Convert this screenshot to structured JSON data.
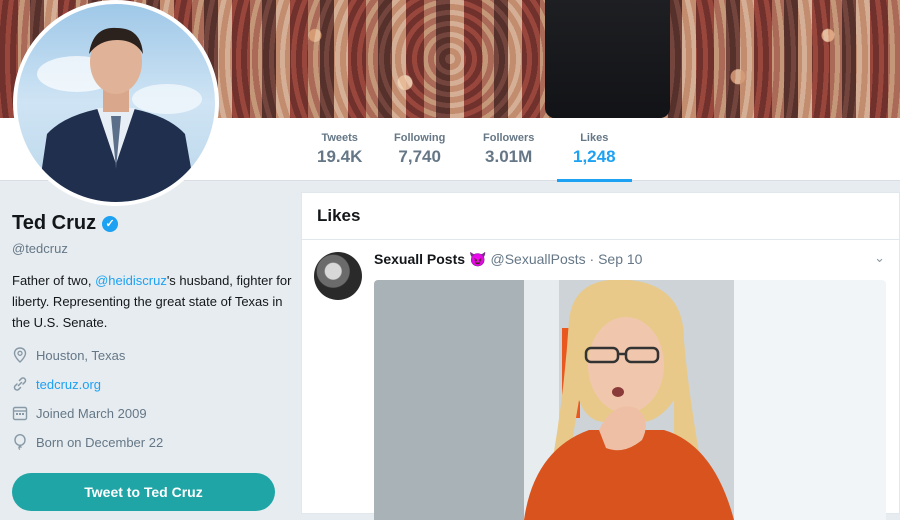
{
  "profile": {
    "name": "Ted Cruz",
    "handle": "@tedcruz",
    "bio_prefix": "Father of two, ",
    "bio_mention": "@heidiscruz",
    "bio_suffix": "'s husband, fighter for liberty. Representing the great state of Texas in the U.S. Senate.",
    "location": "Houston, Texas",
    "website": "tedcruz.org",
    "joined": "Joined March 2009",
    "born": "Born on December 22",
    "tweet_button": "Tweet to Ted Cruz"
  },
  "stats": [
    {
      "label": "Tweets",
      "value": "19.4K"
    },
    {
      "label": "Following",
      "value": "7,740"
    },
    {
      "label": "Followers",
      "value": "3.01M"
    },
    {
      "label": "Likes",
      "value": "1,248"
    }
  ],
  "timeline": {
    "title": "Likes",
    "tweet": {
      "author": "Sexuall Posts",
      "emoji": "😈",
      "handle": "@SexuallPosts",
      "sep": " · ",
      "date": "Sep 10"
    }
  },
  "colors": {
    "accent": "#1da1f2",
    "button": "#1fa5a5"
  },
  "icons": [
    "location-icon",
    "link-icon",
    "calendar-icon",
    "balloon-icon",
    "verified-icon",
    "chevron-down-icon"
  ]
}
